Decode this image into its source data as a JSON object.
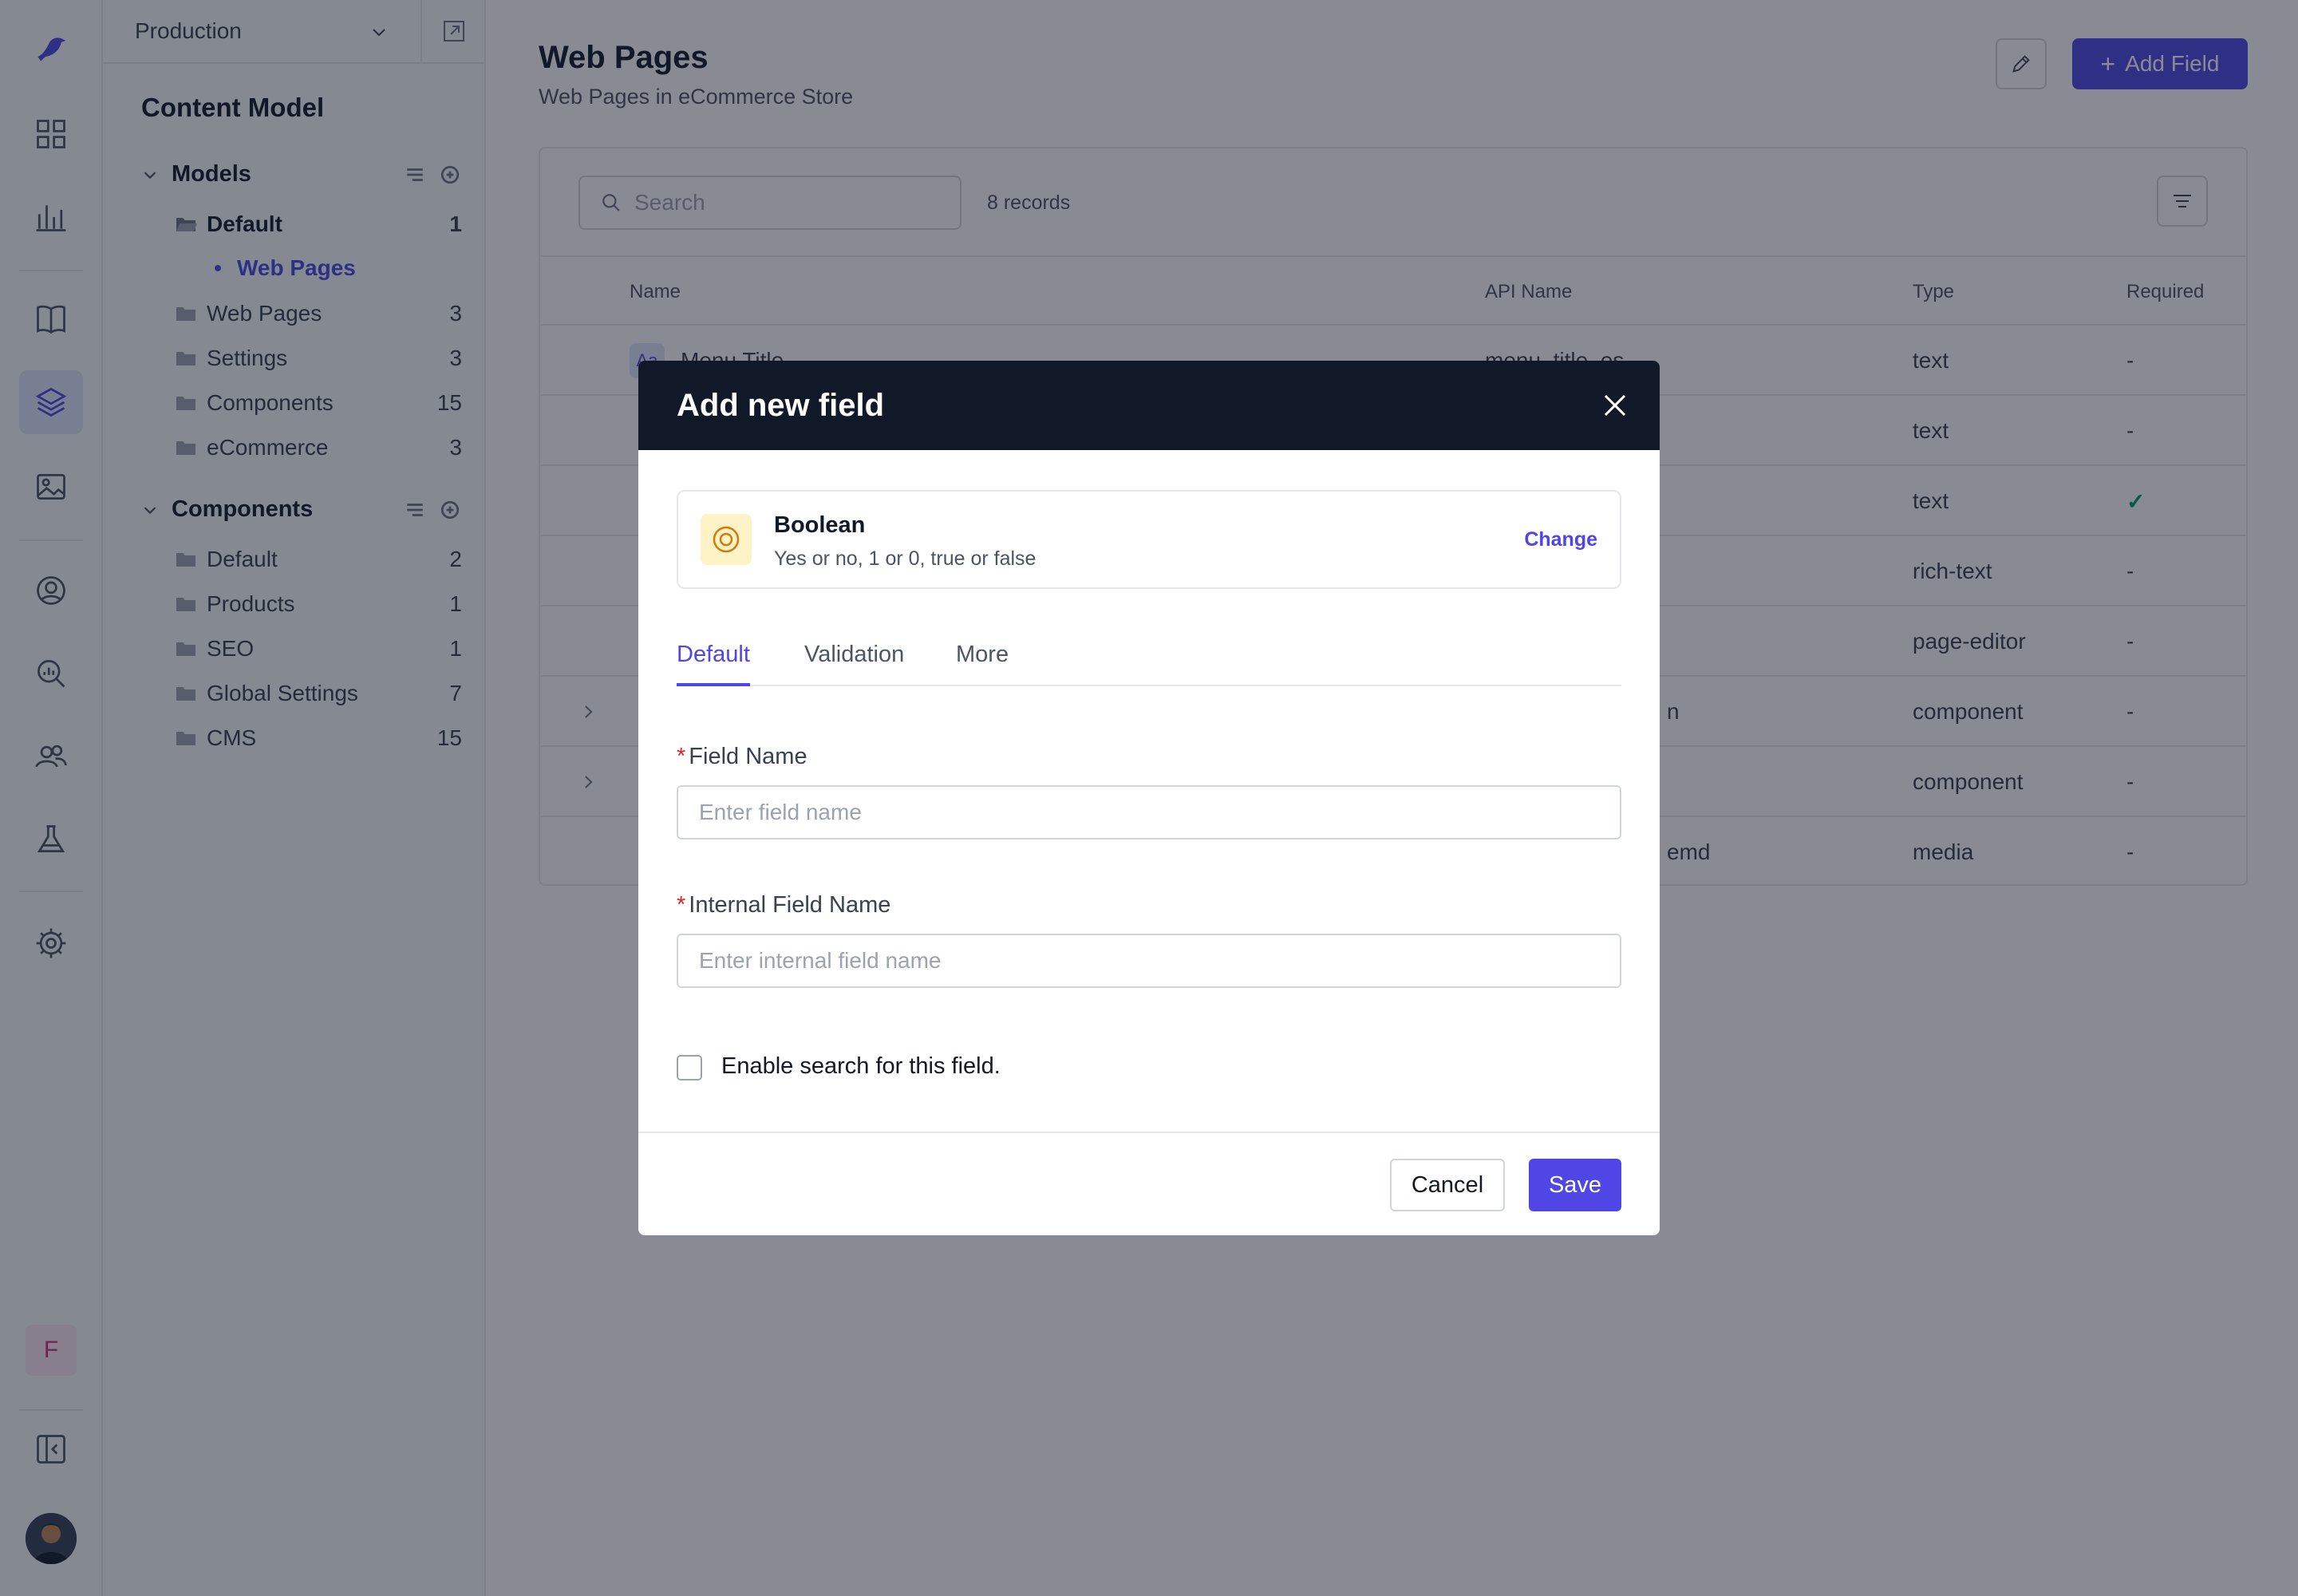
{
  "environment": {
    "selected": "Production"
  },
  "sidebar": {
    "title": "Content Model",
    "models_group": {
      "label": "Models",
      "items": [
        {
          "label": "Default",
          "count": "1"
        },
        {
          "label": "Web Pages",
          "count": "3"
        },
        {
          "label": "Settings",
          "count": "3"
        },
        {
          "label": "Components",
          "count": "15"
        },
        {
          "label": "eCommerce",
          "count": "3"
        }
      ],
      "active_child": "Web Pages"
    },
    "components_group": {
      "label": "Components",
      "items": [
        {
          "label": "Default",
          "count": "2"
        },
        {
          "label": "Products",
          "count": "1"
        },
        {
          "label": "SEO",
          "count": "1"
        },
        {
          "label": "Global Settings",
          "count": "7"
        },
        {
          "label": "CMS",
          "count": "15"
        }
      ]
    }
  },
  "rail": {
    "avatar_initial": "F"
  },
  "main": {
    "title": "Web Pages",
    "subtitle": "Web Pages in eCommerce Store",
    "add_button": "Add Field",
    "search_placeholder": "Search",
    "records": "8 records",
    "columns": [
      "Name",
      "API Name",
      "Type",
      "Required"
    ],
    "rows": [
      {
        "name": "Menu Title",
        "api": "menu_title_es",
        "type": "text",
        "required": "-"
      },
      {
        "name": "",
        "api": "",
        "type": "text",
        "required": "-"
      },
      {
        "name": "",
        "api": "",
        "type": "text",
        "required": "✓"
      },
      {
        "name": "",
        "api": "",
        "type": "rich-text",
        "required": "-"
      },
      {
        "name": "",
        "api": "",
        "type": "page-editor",
        "required": "-"
      },
      {
        "name": "",
        "api": "n",
        "type": "component",
        "required": "-"
      },
      {
        "name": "",
        "api": "",
        "type": "component",
        "required": "-"
      },
      {
        "name": "",
        "api": "emd",
        "type": "media",
        "required": "-"
      }
    ]
  },
  "modal": {
    "title": "Add new field",
    "type_name": "Boolean",
    "type_desc": "Yes or no, 1 or 0, true or false",
    "change_label": "Change",
    "tabs": [
      "Default",
      "Validation",
      "More"
    ],
    "field_name_label": "Field Name",
    "field_name_placeholder": "Enter field name",
    "internal_name_label": "Internal Field Name",
    "internal_name_placeholder": "Enter internal field name",
    "search_checkbox_label": "Enable search for this field.",
    "cancel_label": "Cancel",
    "save_label": "Save"
  },
  "colors": {
    "accent": "#4f46e5",
    "modal_header": "#111827",
    "required_check": "#059669"
  }
}
